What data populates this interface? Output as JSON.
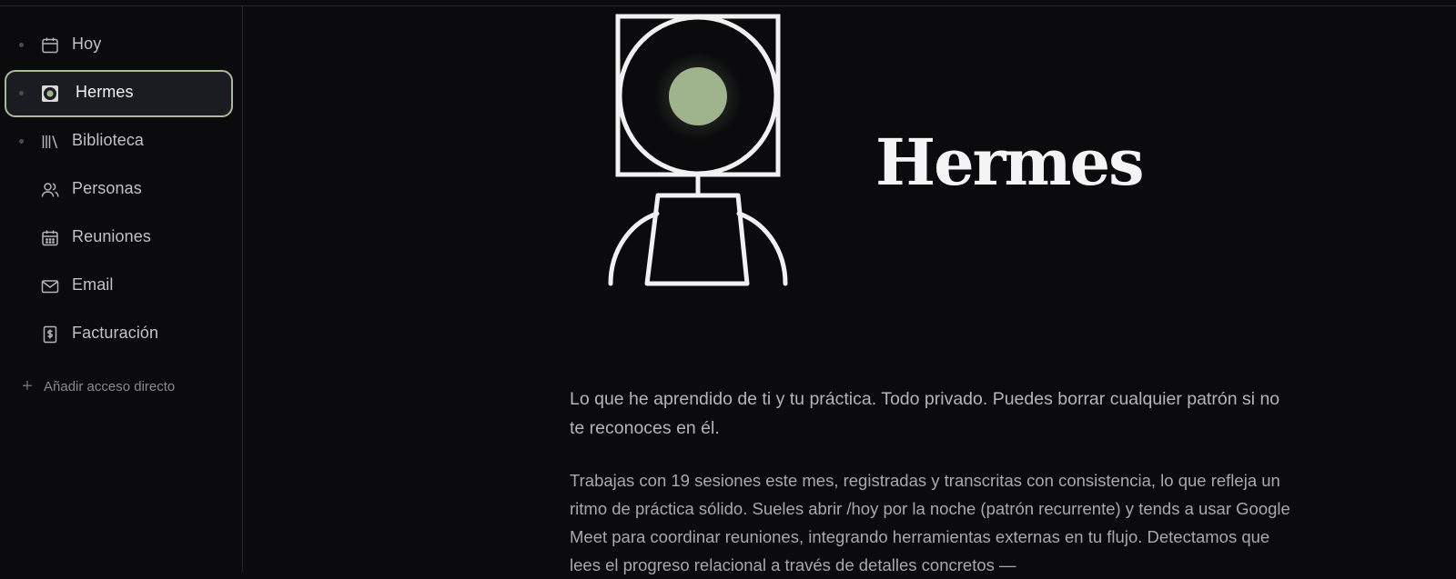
{
  "sidebar": {
    "items": [
      {
        "label": "Hoy",
        "icon": "calendar-icon",
        "bullet": true,
        "active": false
      },
      {
        "label": "Hermes",
        "icon": "hermes-avatar-icon",
        "bullet": true,
        "active": true
      },
      {
        "label": "Biblioteca",
        "icon": "library-icon",
        "bullet": true,
        "active": false
      },
      {
        "label": "Personas",
        "icon": "people-icon",
        "bullet": false,
        "active": false
      },
      {
        "label": "Reuniones",
        "icon": "calendar-grid-icon",
        "bullet": false,
        "active": false
      },
      {
        "label": "Email",
        "icon": "mail-icon",
        "bullet": false,
        "active": false
      },
      {
        "label": "Facturación",
        "icon": "invoice-icon",
        "bullet": false,
        "active": false
      }
    ],
    "add_shortcut_label": "Añadir acceso directo"
  },
  "hero": {
    "title": "Hermes",
    "avatar_icon": "hermes-avatar",
    "accent_color": "#9fb48d"
  },
  "content": {
    "intro": "Lo que he aprendido de ti y tu práctica. Todo privado. Puedes borrar cualquier patrón si no te reconoces en él.",
    "body": "Trabajas con 19 sesiones este mes, registradas y transcritas con consistencia, lo que refleja un ritmo de práctica sólido. Sueles abrir /hoy por la noche (patrón recurrente) y tends a usar Google Meet para coordinar reuniones, integrando herramientas externas en tu flujo. Detectamos que lees el progreso relacional a través de detalles concretos —"
  },
  "colors": {
    "background": "#0b0b0d",
    "active_border": "#a9bb96",
    "accent": "#9fb48d"
  }
}
